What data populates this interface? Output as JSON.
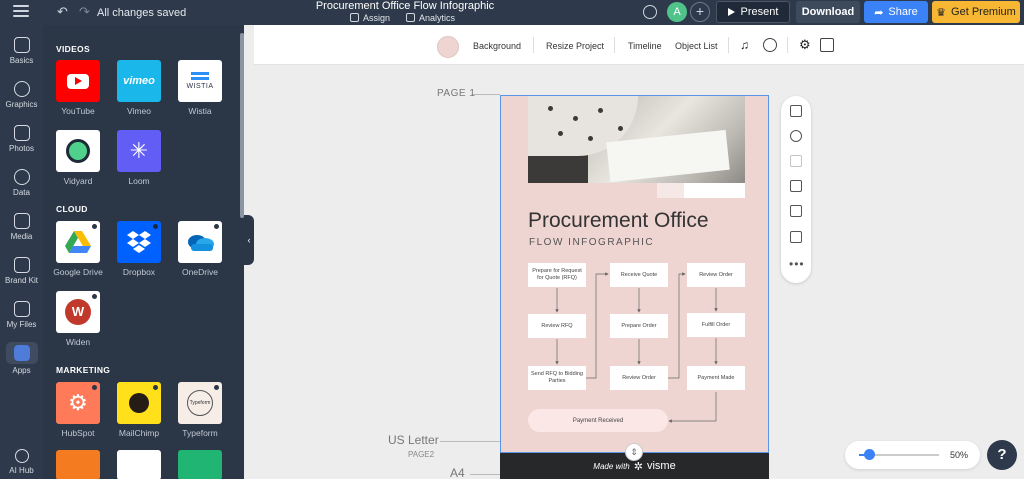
{
  "topbar": {
    "saved_status": "All changes saved",
    "project_title": "Procurement Office Flow Infographic",
    "assign_label": "Assign",
    "analytics_label": "Analytics",
    "avatar_initial": "A",
    "present_label": "Present",
    "download_label": "Download",
    "share_label": "Share",
    "premium_label": "Get Premium"
  },
  "rail": {
    "items": [
      {
        "label": "Basics",
        "icon": "text-icon"
      },
      {
        "label": "Graphics",
        "icon": "shapes-icon"
      },
      {
        "label": "Photos",
        "icon": "image-icon"
      },
      {
        "label": "Data",
        "icon": "chart-icon"
      },
      {
        "label": "Media",
        "icon": "video-icon"
      },
      {
        "label": "Brand Kit",
        "icon": "brand-icon"
      },
      {
        "label": "My Files",
        "icon": "folder-icon"
      },
      {
        "label": "Apps",
        "icon": "apps-grid-icon"
      },
      {
        "label": "AI Hub",
        "icon": "sparkle-icon"
      }
    ]
  },
  "panel": {
    "sections": [
      {
        "title": "VIDEOS"
      },
      {
        "title": "CLOUD"
      },
      {
        "title": "MARKETING"
      }
    ],
    "apps": [
      {
        "label": "YouTube",
        "tile_color": "#ff0000"
      },
      {
        "label": "Vimeo",
        "tile_color": "#1ab7ea",
        "logo_text": "vimeo"
      },
      {
        "label": "Wistia",
        "tile_color": "#ffffff",
        "logo_text": "WISTIA"
      },
      {
        "label": "Vidyard",
        "tile_color": "#ffffff"
      },
      {
        "label": "Loom",
        "tile_color": "#625df5"
      },
      {
        "label": "Google Drive",
        "tile_color": "#ffffff"
      },
      {
        "label": "Dropbox",
        "tile_color": "#0061ff"
      },
      {
        "label": "OneDrive",
        "tile_color": "#ffffff"
      },
      {
        "label": "Widen",
        "tile_color": "#ffffff"
      },
      {
        "label": "HubSpot",
        "tile_color": "#ff7a59"
      },
      {
        "label": "MailChimp",
        "tile_color": "#ffe01b"
      },
      {
        "label": "Typeform",
        "tile_color": "#f5ede6",
        "logo_text": "Typeform"
      }
    ]
  },
  "toolbar": {
    "background_label": "Background",
    "background_color": "#efd5d2",
    "resize_label": "Resize Project",
    "timeline_label": "Timeline",
    "object_list_label": "Object List"
  },
  "canvas": {
    "page1_label": "PAGE 1",
    "size_label": "US Letter",
    "page2_label": "PAGE2",
    "a4_label": "A4",
    "made_with_label": "Made with",
    "brand_label": "visme"
  },
  "infographic": {
    "title": "Procurement Office",
    "subtitle": "FLOW INFOGRAPHIC",
    "steps": [
      "Prepare for Request for Quote (RFQ)",
      "Review RFQ",
      "Send RFQ to Bidding Parties",
      "Receive Quote",
      "Prepare Order",
      "Review Order",
      "Review Order",
      "Fulfill Order",
      "Payment Made"
    ],
    "final_step": "Payment Received"
  },
  "zoom": {
    "level": "50%",
    "slider_fraction": 0.12
  },
  "help_label": "?"
}
